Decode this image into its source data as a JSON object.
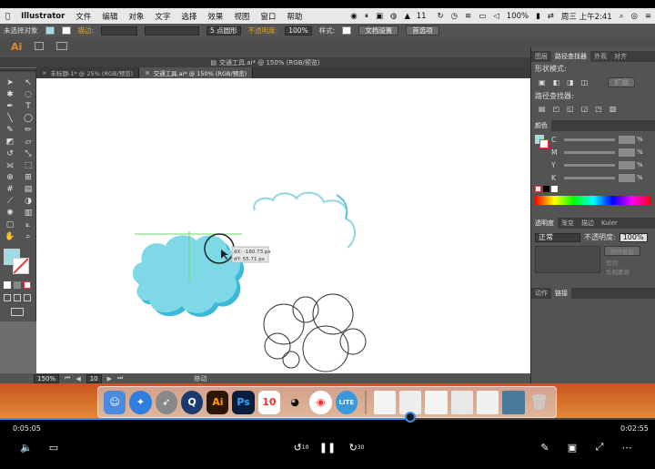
{
  "menubar": {
    "app": "Illustrator",
    "items": [
      "文件",
      "编辑",
      "对象",
      "文字",
      "选择",
      "效果",
      "视图",
      "窗口",
      "帮助"
    ],
    "status_ai": "11",
    "battery": "100%",
    "clock": "周三 上午2:41"
  },
  "control_bar": {
    "no_selection": "未选择对象",
    "stroke_label": "描边:",
    "brush_value": "5 点圆形",
    "opacity_label": "不透明度:",
    "opacity_value": "100%",
    "style_label": "样式:",
    "doc_setup": "文档设置",
    "preferences": "首选项"
  },
  "app_logo": "Ai",
  "doc_title": "交通工具.ai* @ 150% (RGB/预览)",
  "tabs": [
    {
      "label": "未标题-1* @ 25% (RGB/预览)"
    },
    {
      "label": "交通工具.ai* @ 150% (RGB/预览)"
    }
  ],
  "canvas": {
    "tooltip_dx": "dX: -160.73 px",
    "tooltip_dy": "dY: 55.71 px"
  },
  "status_bar": {
    "zoom": "150%",
    "page": "10",
    "tool": "移动"
  },
  "panels": {
    "top_tabs": [
      "图层",
      "路径查找器",
      "外观",
      "对齐"
    ],
    "shape_mode": "形状模式:",
    "expand": "扩展",
    "pathfinder": "路径查找器:",
    "color_tab": "颜色",
    "cmyk": [
      "C",
      "M",
      "Y",
      "K"
    ],
    "transparency_tabs": [
      "透明度",
      "渐变",
      "描边",
      "Kuler"
    ],
    "blend_mode": "正常",
    "opacity_label": "不透明度:",
    "opacity_value": "100%",
    "make_mask": "制作蒙版",
    "clip": "剪切",
    "invert_mask": "反相蒙版",
    "bottom_tabs": [
      "动作",
      "链接"
    ]
  },
  "dock": {
    "icons": [
      "Finder",
      "Safari",
      "Launchpad",
      "QuickTime",
      "Ai",
      "Ps",
      "10",
      "QQ",
      "Chrome",
      "LITE"
    ]
  },
  "player": {
    "elapsed": "0:05:05",
    "remaining": "0:02:55",
    "progress": 0.626,
    "rewind": "10",
    "forward": "30"
  }
}
